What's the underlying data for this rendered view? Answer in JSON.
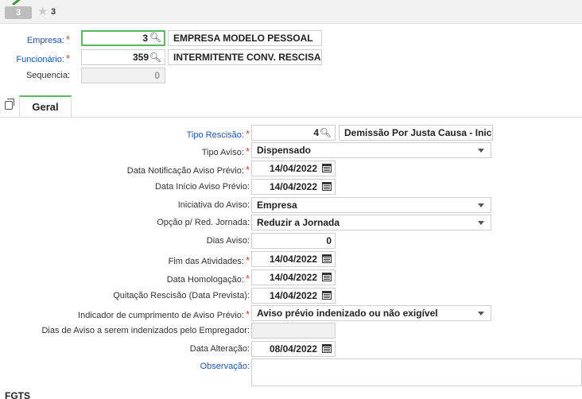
{
  "topbar": {
    "tab_number": "3",
    "favorites_count": "3"
  },
  "header": {
    "empresa": {
      "label": "Empresa:",
      "value": "3",
      "description": "EMPRESA MODELO PESSOAL"
    },
    "funcionario": {
      "label": "Funcionário:",
      "value": "359",
      "description": "INTERMITENTE CONV. RESCISA"
    },
    "sequencia": {
      "label": "Sequencia:",
      "value": "0"
    }
  },
  "tabs": [
    {
      "label": "Geral"
    }
  ],
  "form": {
    "tipo_rescisao": {
      "label": "Tipo Rescisão:",
      "value": "4",
      "description": "Demissão Por Justa Causa - Inic"
    },
    "tipo_aviso": {
      "label": "Tipo Aviso:",
      "value": "Dispensado"
    },
    "data_notificacao": {
      "label": "Data Notificação Aviso Prévio:",
      "value": "14/04/2022"
    },
    "data_inicio": {
      "label": "Data Início Aviso Prévio:",
      "value": "14/04/2022"
    },
    "iniciativa": {
      "label": "Iniciativa do Aviso:",
      "value": "Empresa"
    },
    "opcao_red": {
      "label": "Opção p/ Red. Jornada:",
      "value": "Reduzir a Jornada"
    },
    "dias_aviso": {
      "label": "Dias Aviso:",
      "value": "0"
    },
    "fim_atividades": {
      "label": "Fim das Atividades:",
      "value": "14/04/2022"
    },
    "data_homologacao": {
      "label": "Data Homologação:",
      "value": "14/04/2022"
    },
    "quitacao": {
      "label": "Quitação Rescisão (Data Prevista):",
      "value": "14/04/2022"
    },
    "indicador": {
      "label": "Indicador de cumprimento de Aviso Prévio:",
      "value": "Aviso prévio indenizado ou não exigível"
    },
    "dias_indenizados": {
      "label": "Dias de Aviso a serem indenizados pelo Empregador:",
      "value": ""
    },
    "data_alteracao": {
      "label": "Data Alteração:",
      "value": "08/04/2022"
    },
    "observacao": {
      "label": "Observação:",
      "value": ""
    }
  },
  "footer": {
    "section_label": "FGTS"
  },
  "colors": {
    "accent_green": "#5cb85c",
    "required_red": "#e53935",
    "link_blue": "#1a56c4"
  }
}
